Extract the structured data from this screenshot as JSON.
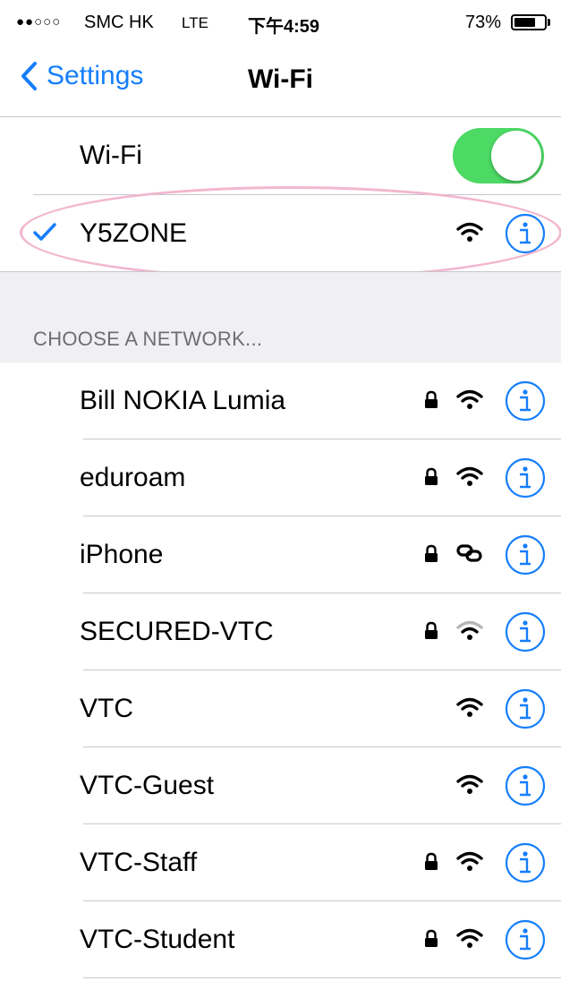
{
  "status_bar": {
    "signal": "●●○○○",
    "carrier": "SMC HK",
    "network": "LTE",
    "time": "下午4:59",
    "battery_percent": "73%",
    "battery_level": 0.73
  },
  "nav": {
    "back_label": "Settings",
    "title": "Wi-Fi"
  },
  "wifi_toggle": {
    "label": "Wi-Fi",
    "on": true
  },
  "connected": {
    "name": "Y5ZONE",
    "locked": false,
    "signal": "full"
  },
  "section_header": "CHOOSE A NETWORK...",
  "networks": [
    {
      "name": "Bill NOKIA Lumia",
      "locked": true,
      "icon": "wifi-icon",
      "signal": "full"
    },
    {
      "name": "eduroam",
      "locked": true,
      "icon": "wifi-icon",
      "signal": "full"
    },
    {
      "name": "iPhone",
      "locked": true,
      "icon": "personal-hotspot-link-icon",
      "signal": "full"
    },
    {
      "name": "SECURED-VTC",
      "locked": true,
      "icon": "wifi-icon",
      "signal": "medium"
    },
    {
      "name": "VTC",
      "locked": false,
      "icon": "wifi-icon",
      "signal": "full"
    },
    {
      "name": "VTC-Guest",
      "locked": false,
      "icon": "wifi-icon",
      "signal": "full"
    },
    {
      "name": "VTC-Staff",
      "locked": true,
      "icon": "wifi-icon",
      "signal": "full"
    },
    {
      "name": "VTC-Student",
      "locked": true,
      "icon": "wifi-icon",
      "signal": "full"
    }
  ],
  "colors": {
    "accent": "#157efb",
    "toggle_on": "#4cd964",
    "group_background": "#efeff4",
    "separator": "#c8c7cc",
    "annotation_ellipse": "#f2b6cf"
  }
}
